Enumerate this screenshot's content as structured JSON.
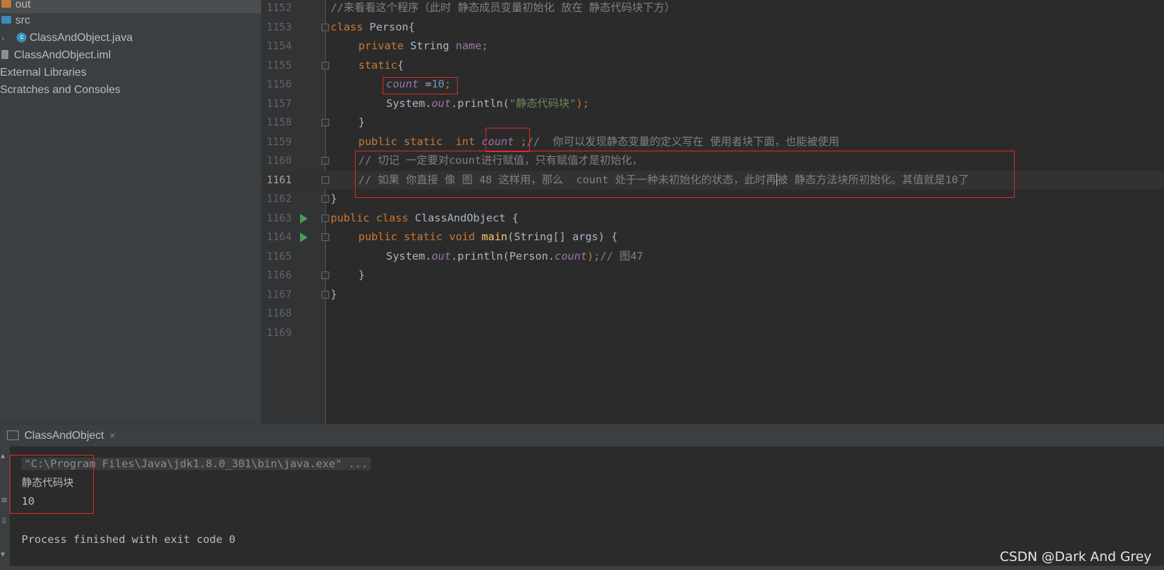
{
  "project_tree": {
    "items": [
      {
        "label": "out",
        "icon": "folder-icon",
        "color": "#c07a3a"
      },
      {
        "label": "src",
        "icon": "folder-icon",
        "color": "#3d8ab8"
      },
      {
        "label": "ClassAndObject.java",
        "icon": "java-class-icon"
      },
      {
        "label": "ClassAndObject.iml",
        "icon": "module-file-icon"
      },
      {
        "label": "External Libraries",
        "icon": "library-icon"
      },
      {
        "label": "Scratches and Consoles",
        "icon": "scratch-icon"
      }
    ]
  },
  "editor": {
    "current_line": "1161",
    "lines": [
      {
        "num": "1152",
        "c1": "//来看看这个程序（此时 静态成员变量初始化 放在 静态代码块下方）"
      },
      {
        "num": "1153",
        "c1": "class",
        "c2": " Person{"
      },
      {
        "num": "1154",
        "c1": "private",
        "c2": " String ",
        "c3": "name",
        "c4": ";"
      },
      {
        "num": "1155",
        "c1": "static",
        "c2": "{"
      },
      {
        "num": "1156",
        "c1": "count",
        "c2": " =",
        "c3": "10",
        "c4": ";"
      },
      {
        "num": "1157",
        "c1": "System.",
        "c2": "out",
        "c3": ".println(",
        "c4": "\"静态代码块\"",
        "c5": ");"
      },
      {
        "num": "1158",
        "c1": "}"
      },
      {
        "num": "1159",
        "c1": "public static  int ",
        "c2": "count",
        "c3": " ;",
        "c4": "//  你可以发现静态变量的定义写在 使用者块下面，也能被使用"
      },
      {
        "num": "1160",
        "c1": "// 切记 一定要对count进行赋值，只有赋值才是初始化，"
      },
      {
        "num": "1161",
        "c1": "// 如果 你直接 像 图 48 这样用，那么  count 处于一种未初始化的状态，此时再",
        "c2": "被 静态方法块所初始化。其值就是10了"
      },
      {
        "num": "1162",
        "c1": "}"
      },
      {
        "num": "1163",
        "c1": "public class",
        "c2": " ClassAndObject {"
      },
      {
        "num": "1164",
        "c1": "public static void ",
        "c2": "main",
        "c3": "(String[] args) {"
      },
      {
        "num": "1165",
        "c1": "System.",
        "c2": "out",
        "c3": ".println(Person.",
        "c4": "count",
        "c5": ");",
        "c6": "// 图47"
      },
      {
        "num": "1166",
        "c1": "}"
      },
      {
        "num": "1167",
        "c1": "}"
      },
      {
        "num": "1168"
      },
      {
        "num": "1169"
      }
    ]
  },
  "run_panel": {
    "tab_label": "ClassAndObject",
    "close_glyph": "×",
    "command": "\"C:\\Program Files\\Java\\jdk1.8.0_301\\bin\\java.exe\" ...",
    "output": [
      "静态代码块",
      "10"
    ],
    "exit_message": "Process finished with exit code 0"
  },
  "watermark": "CSDN @Dark And Grey",
  "colors": {
    "keyword": "#cc7832",
    "field": "#9876aa",
    "string": "#6a8759",
    "number": "#6897bb",
    "comment": "#808080",
    "method": "#ffc66d",
    "annotation_box": "#e02c2c",
    "run_icon": "#499c54"
  }
}
